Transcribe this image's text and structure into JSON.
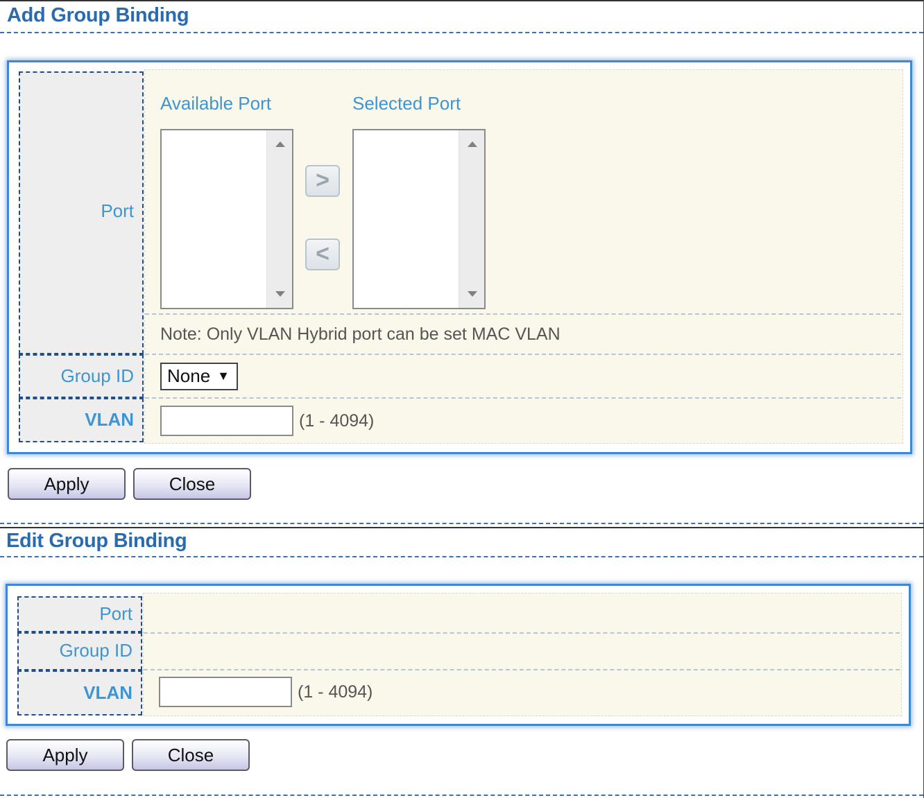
{
  "add_section": {
    "title": "Add Group Binding",
    "labels": {
      "port": "Port",
      "group_id": "Group ID",
      "vlan": "VLAN"
    },
    "available_port_header": "Available Port",
    "selected_port_header": "Selected Port",
    "move_right_symbol": ">",
    "move_left_symbol": "<",
    "note": "Note: Only VLAN Hybrid port can be set MAC VLAN",
    "group_id_value": "None",
    "vlan_value": "",
    "vlan_range": "(1 - 4094)",
    "apply_label": "Apply",
    "close_label": "Close"
  },
  "edit_section": {
    "title": "Edit Group Binding",
    "labels": {
      "port": "Port",
      "group_id": "Group ID",
      "vlan": "VLAN"
    },
    "vlan_value": "",
    "vlan_range": "(1 - 4094)",
    "apply_label": "Apply",
    "close_label": "Close"
  },
  "icons": {
    "move_right": "chevron-right-icon",
    "move_left": "chevron-left-icon",
    "dropdown": "caret-down-icon",
    "scroll_up": "scroll-up-arrow-icon",
    "scroll_down": "scroll-down-arrow-icon"
  },
  "colors": {
    "title": "#2a6bb0",
    "label": "#3d95d4",
    "panel_border": "#3f86d6",
    "panel_background": "#faf8ea"
  }
}
